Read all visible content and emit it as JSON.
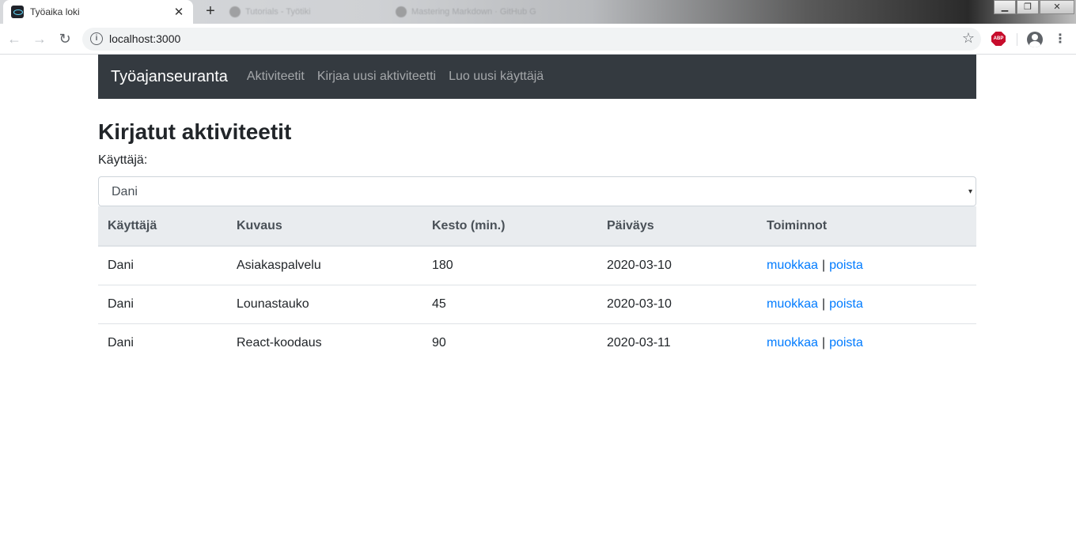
{
  "browser": {
    "tab_title": "Työaika loki",
    "tab_close": "✕",
    "new_tab": "+",
    "bg_tab_1": "Tutorials - Työtiki",
    "bg_tab_2": "Mastering Markdown · GitHub G",
    "url": "localhost:3000",
    "info_glyph": "i",
    "star_glyph": "☆",
    "abp_label": "ABP",
    "menu_glyph": "⋮",
    "back_glyph": "←",
    "forward_glyph": "→",
    "reload_glyph": "↻",
    "win_min": "▁",
    "win_restore": "❐",
    "win_close": "✕"
  },
  "navbar": {
    "brand": "Työajanseuranta",
    "links": [
      "Aktiviteetit",
      "Kirjaa uusi aktiviteetti",
      "Luo uusi käyttäjä"
    ],
    "bg_color": "#343a40"
  },
  "main": {
    "title": "Kirjatut aktiviteetit",
    "user_label": "Käyttäjä:",
    "selected_user": "Dani",
    "select_arrow": "▾"
  },
  "table": {
    "headers": [
      "Käyttäjä",
      "Kuvaus",
      "Kesto (min.)",
      "Päiväys",
      "Toiminnot"
    ],
    "rows": [
      {
        "user": "Dani",
        "description": "Asiakaspalvelu",
        "duration": "180",
        "date": "2020-03-10",
        "edit": "muokkaa",
        "separator": "|",
        "delete": "poista"
      },
      {
        "user": "Dani",
        "description": "Lounastauko",
        "duration": "45",
        "date": "2020-03-10",
        "edit": "muokkaa",
        "separator": "|",
        "delete": "poista"
      },
      {
        "user": "Dani",
        "description": "React-koodaus",
        "duration": "90",
        "date": "2020-03-11",
        "edit": "muokkaa",
        "separator": "|",
        "delete": "poista"
      }
    ]
  },
  "colors": {
    "link": "#007bff",
    "header_bg": "#e9ecef"
  }
}
